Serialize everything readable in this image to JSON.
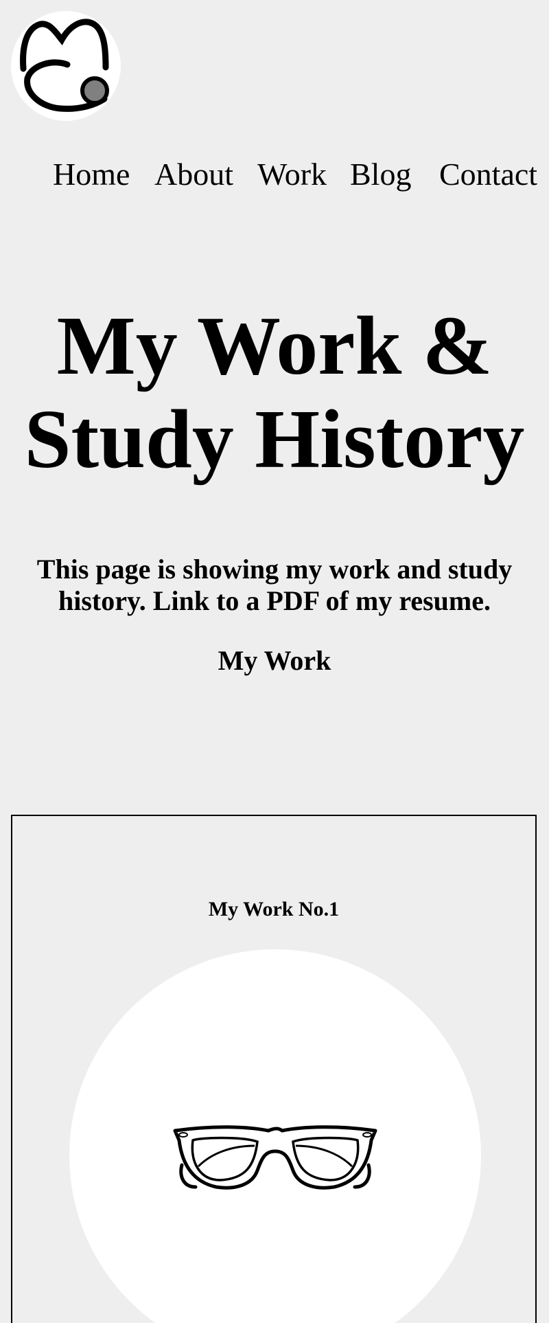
{
  "nav": {
    "items": [
      {
        "label": "Home"
      },
      {
        "label": "About"
      },
      {
        "label": "Work"
      },
      {
        "label": "Blog"
      },
      {
        "label": "Contact"
      }
    ]
  },
  "hero": {
    "title_line1": "My Work &",
    "title_line2": "Study History"
  },
  "intro": {
    "text": "This page is showing my work and study history.",
    "link_label": "Link to a PDF of my resume."
  },
  "section": {
    "heading": "My Work"
  },
  "works": [
    {
      "title": "My Work No.1",
      "image_icon": "glasses-icon"
    }
  ],
  "colors": {
    "background": "#eeeeee",
    "text": "#000000",
    "circle": "#ffffff",
    "logo_dot": "#808080"
  }
}
